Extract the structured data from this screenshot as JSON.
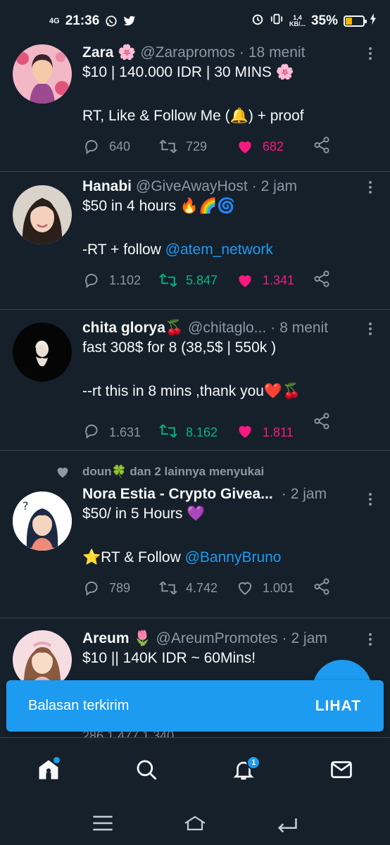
{
  "status_bar": {
    "network": "4G",
    "time": "21:36",
    "speed_value": "1,4",
    "speed_unit": "KB/...",
    "battery_percent": "35%",
    "battery_level": 0.35
  },
  "tweets": [
    {
      "name": "Zara 🌸",
      "handle": "@Zarapromos",
      "time": "18 menit",
      "lines": [
        "$10 | 140.000 IDR | 30 MINS 🌸",
        "",
        "RT, Like & Follow Me (🔔) + proof"
      ],
      "replies": "640",
      "retweets": "729",
      "likes": "682",
      "liked": true,
      "retweeted": false
    },
    {
      "name": "Hanabi",
      "handle": "@GiveAwayHost",
      "time": "2 jam",
      "line1": "$50 in 4 hours 🔥🌈🌀",
      "line3_prefix": "-RT + follow ",
      "line3_mention": "@atem_network",
      "replies": "1.102",
      "retweets": "5.847",
      "likes": "1.341",
      "liked": true,
      "retweeted": true
    },
    {
      "name": "chita glorya🍒",
      "handle": "@chitaglo...",
      "time": "8 menit",
      "lines": [
        "fast 308$ for 8 (38,5$ | 550k )",
        "",
        "--rt this in 8 mins ,thank you❤️🍒"
      ],
      "replies": "1.631",
      "retweets": "8.162",
      "likes": "1.811",
      "liked": true,
      "retweeted": true
    },
    {
      "social_context": "doun🍀 dan 2 lainnya menyukai",
      "name": "Nora Estia - Crypto Givea...",
      "handle": "",
      "time": "2 jam",
      "line1": "$50/ in 5 Hours  💜",
      "line3_prefix": "⭐RT & Follow ",
      "line3_mention": "@BannyBruno",
      "replies": "789",
      "retweets": "4.742",
      "likes": "1.001",
      "liked": false,
      "retweeted": false
    },
    {
      "name": "Areum 🌷",
      "handle": "@AreumPromotes",
      "time": "2 jam",
      "line1": "$10 || 140K IDR ~ 60Mins!",
      "peek": "286      1.477      1.340"
    }
  ],
  "toast": {
    "message": "Balasan terkirim",
    "action": "LIHAT"
  },
  "bottom_nav": {
    "notification_count": "1"
  },
  "colors": {
    "background": "#15202b",
    "accent": "#1d9bf0",
    "like": "#f91880",
    "retweet": "#00ba7c",
    "muted": "#8b98a5"
  }
}
